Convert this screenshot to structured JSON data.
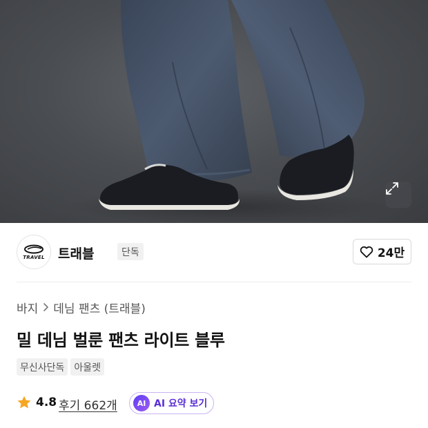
{
  "hero": {
    "expand_icon": "expand-arrows-icon"
  },
  "brand": {
    "logo_text": "TRAVEL",
    "name": "트래블",
    "badge": "단독",
    "like_icon": "heart-outline-icon",
    "like_count": "24만"
  },
  "breadcrumb": {
    "items": [
      "바지",
      "데님 팬츠 (트래블)"
    ]
  },
  "product": {
    "title": "밀 데님 벌룬 팬츠 라이트 블루",
    "tags": [
      "무신사단독",
      "아울렛"
    ]
  },
  "rating": {
    "star_icon": "star-filled-icon",
    "value": "4.8",
    "reviews_label": "후기 662개",
    "ai_badge": "AI",
    "ai_label": "AI 요약 보기"
  },
  "colors": {
    "star": "#f6a623",
    "ai_accent": "#5a2fd6",
    "ai_border": "#c9b3f2"
  }
}
